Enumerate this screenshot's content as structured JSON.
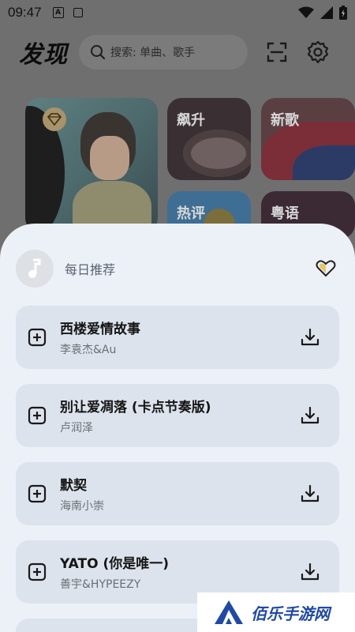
{
  "status_bar": {
    "time": "09:47",
    "notif_letter": "A"
  },
  "header": {
    "title": "发现",
    "search_placeholder": "搜索: 单曲、歌手"
  },
  "cards": {
    "surge": "飙升",
    "new": "新歌",
    "hot": "热评",
    "canto": "粤语"
  },
  "sheet": {
    "playlist_title": "每日推荐",
    "songs": [
      {
        "title": "西楼爱情故事",
        "artist": "李袁杰&Au"
      },
      {
        "title": "别让爱凋落 (卡点节奏版)",
        "artist": "卢润泽"
      },
      {
        "title": "默契",
        "artist": "海南小崇"
      },
      {
        "title": "YATO (你是唯一)",
        "artist": "善宇&HYPEEZY"
      }
    ]
  },
  "watermark": {
    "text": "佰乐手游网"
  },
  "colors": {
    "overlay_bg": "#6f6f6f",
    "sheet_bg": "#ecf1f8",
    "song_card_bg": "#dde3ec",
    "heart_accent": "#e7c66a",
    "watermark_blue": "#1f49a8"
  }
}
